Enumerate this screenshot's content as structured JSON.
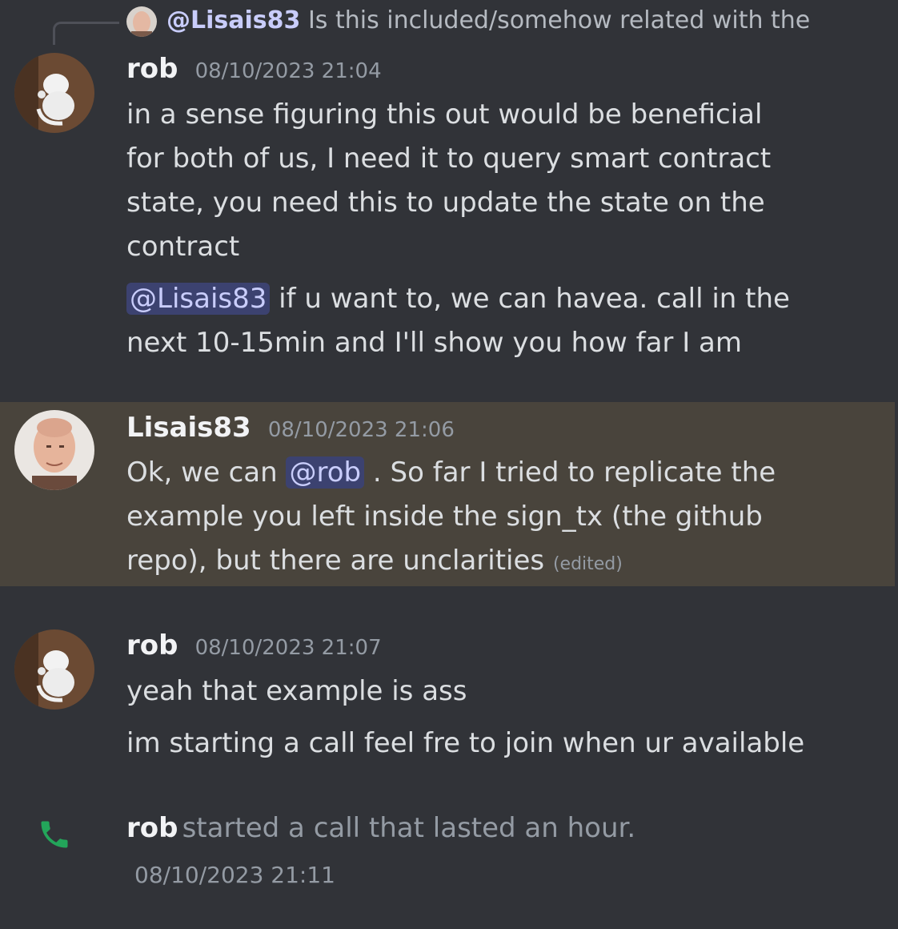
{
  "reply": {
    "name": "@Lisais83",
    "text": "Is this included/somehow related with the"
  },
  "messages": [
    {
      "username": "rob",
      "timestamp": "08/10/2023 21:04",
      "lines": [
        "in a sense figuring this out would be beneficial",
        "for both of us, I need it to query smart contract",
        "state, you need this to update the state on the",
        "contract"
      ],
      "followup": {
        "mention": "@Lisais83",
        "line1": " if u want to, we can havea. call in the",
        "line2": "next 10-15min and I'll show you how far I am"
      }
    },
    {
      "username": "Lisais83",
      "timestamp": "08/10/2023 21:06",
      "line1_pre": "Ok, we can ",
      "mention": "@rob",
      "line1_post": " . So far I tried to replicate the",
      "line2": "example you left inside the sign_tx (the github",
      "line3": "repo), but there are unclarities",
      "edited": "(edited)"
    },
    {
      "username": "rob",
      "timestamp": "08/10/2023 21:07",
      "line1": "yeah that example is ass",
      "line2": "im starting a call feel fre to join when ur available"
    }
  ],
  "call": {
    "username": "rob",
    "text": "started a call that lasted an hour.",
    "timestamp": "08/10/2023 21:11",
    "icon_color": "#23a55a"
  },
  "colors": {
    "background": "#313338",
    "highlight": "#49443c",
    "mention_bg": "#3c4270",
    "mention_text": "#c9cdfb"
  }
}
